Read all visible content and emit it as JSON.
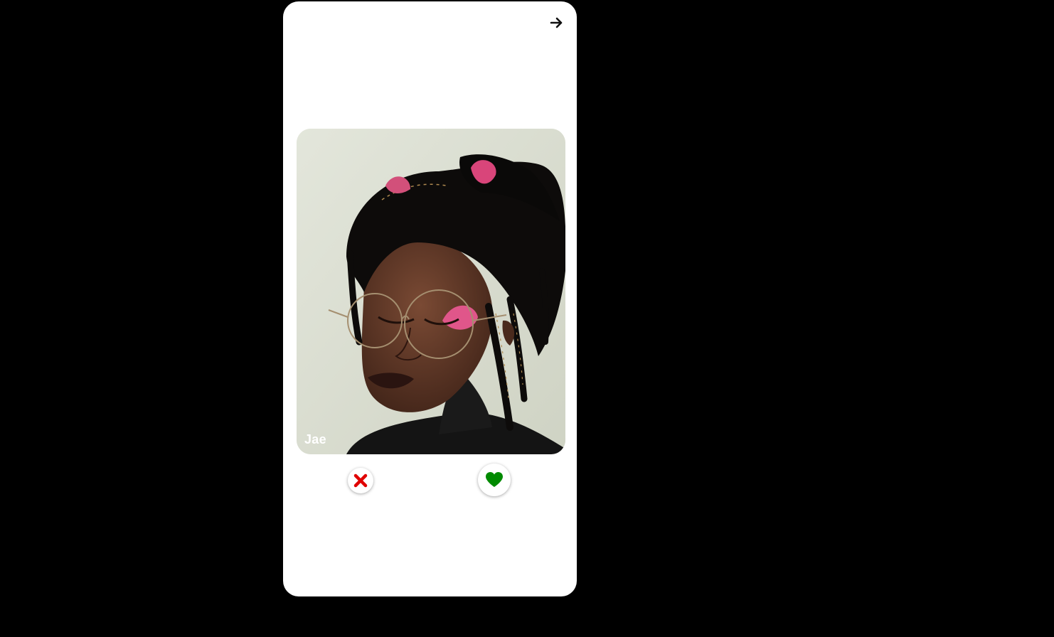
{
  "profile": {
    "name": "Jae"
  },
  "icons": {
    "next": "arrow-right-icon",
    "dislike": "x-icon",
    "like": "heart-icon"
  },
  "colors": {
    "background": "#000000",
    "phone": "#ffffff",
    "dislike": "#e00000",
    "like": "#008a00"
  }
}
